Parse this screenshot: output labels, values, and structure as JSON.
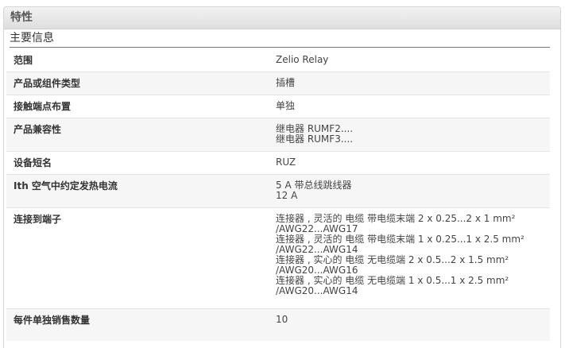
{
  "panel": {
    "title": "特性"
  },
  "section": {
    "title": "主要信息"
  },
  "rows": [
    {
      "label": "范围",
      "values": [
        "Zelio Relay"
      ]
    },
    {
      "label": "产品或组件类型",
      "values": [
        "插槽"
      ]
    },
    {
      "label": "接触端点布置",
      "values": [
        "单独"
      ]
    },
    {
      "label": "产品兼容性",
      "values": [
        "继电器 RUMF2....",
        "继电器 RUMF3...."
      ]
    },
    {
      "label": "设备短名",
      "values": [
        "RUZ"
      ]
    },
    {
      "label": "Ith 空气中约定发热电流",
      "values": [
        "5 A 带总线跳线器",
        "12 A"
      ]
    },
    {
      "label": "连接到端子",
      "values": [
        "连接器 , 灵活的 电缆 带电缆末端 2 x 0.25...2 x 1 mm²",
        "/AWG22...AWG17",
        "连接器 , 灵活的 电缆 带电缆末端 1 x 0.25...1 x 2.5 mm²",
        "/AWG22...AWG14",
        "连接器 , 实心的 电缆 无电缆端 2 x 0.5...2 x 1.5 mm²",
        "/AWG20...AWG16",
        "连接器 , 实心的 电缆 无电缆端 1 x 0.5...1 x 2.5 mm²",
        "/AWG20...AWG14"
      ]
    },
    {
      "label": "每件单独销售数量",
      "values": [
        "10"
      ]
    }
  ]
}
